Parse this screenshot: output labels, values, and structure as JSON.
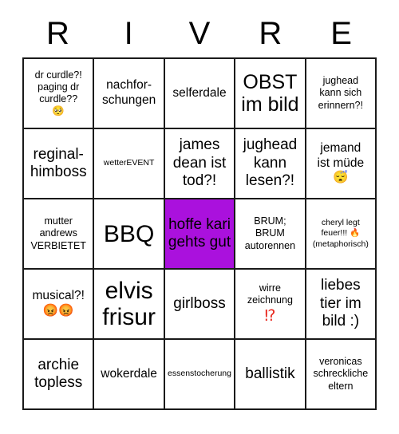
{
  "card": {
    "header_letters": [
      "R",
      "I",
      "V",
      "R",
      "E"
    ],
    "marked_color": "#aa11dd",
    "accent_red": "#e8261c",
    "grid_line_color": "#1a1a1a",
    "rows": [
      [
        {
          "text": "dr curdle?!\npaging dr\ncurdle??\n🥺",
          "size": "sm",
          "marked": false
        },
        {
          "text": "nachfor-\nschungen",
          "size": "md",
          "marked": false
        },
        {
          "text": "selferdale",
          "size": "md",
          "marked": false
        },
        {
          "text": "OBST\nim bild",
          "size": "xl",
          "marked": false
        },
        {
          "text": "jughead\nkann sich\nerinnern?!",
          "size": "sm",
          "marked": false
        }
      ],
      [
        {
          "text": "reginal-\nhimboss",
          "size": "lg",
          "marked": false
        },
        {
          "text": "wetterEVENT",
          "size": "xs",
          "marked": false
        },
        {
          "text": "james\ndean ist\ntod?!",
          "size": "lg",
          "marked": false
        },
        {
          "text": "jughead\nkann\nlesen?!",
          "size": "lg",
          "marked": false
        },
        {
          "text": "jemand\nist müde\n😴",
          "size": "md",
          "marked": false
        }
      ],
      [
        {
          "text": "mutter\nandrews\nVERBIETET",
          "size": "sm",
          "marked": false
        },
        {
          "text": "BBQ",
          "size": "xxl",
          "marked": false
        },
        {
          "text": "hoffe kari\ngehts gut",
          "size": "lg",
          "marked": true
        },
        {
          "text": "BRUM;\nBRUM\nautorennen",
          "size": "sm",
          "marked": false
        },
        {
          "text": "cheryl legt\nfeuer!!! 🔥\n(metaphorisch)",
          "size": "xs",
          "marked": false
        }
      ],
      [
        {
          "text": "musical?!\n😡😡",
          "size": "md",
          "marked": false
        },
        {
          "text": "elvis\nfrisur",
          "size": "xxl",
          "marked": false
        },
        {
          "text": "girlboss",
          "size": "lg",
          "marked": false
        },
        {
          "text": "wirre\nzeichnung",
          "size": "sm",
          "marked": false,
          "suffix": "⁉",
          "suffix_style": "accent-red"
        },
        {
          "text": "liebes\ntier im\nbild :)",
          "size": "lg",
          "marked": false
        }
      ],
      [
        {
          "text": "archie\ntopless",
          "size": "lg",
          "marked": false
        },
        {
          "text": "wokerdale",
          "size": "md",
          "marked": false
        },
        {
          "text": "essenstocherung",
          "size": "xs",
          "marked": false
        },
        {
          "text": "ballistik",
          "size": "lg",
          "marked": false
        },
        {
          "text": "veronicas\nschreckliche\neltern",
          "size": "sm",
          "marked": false
        }
      ]
    ]
  }
}
